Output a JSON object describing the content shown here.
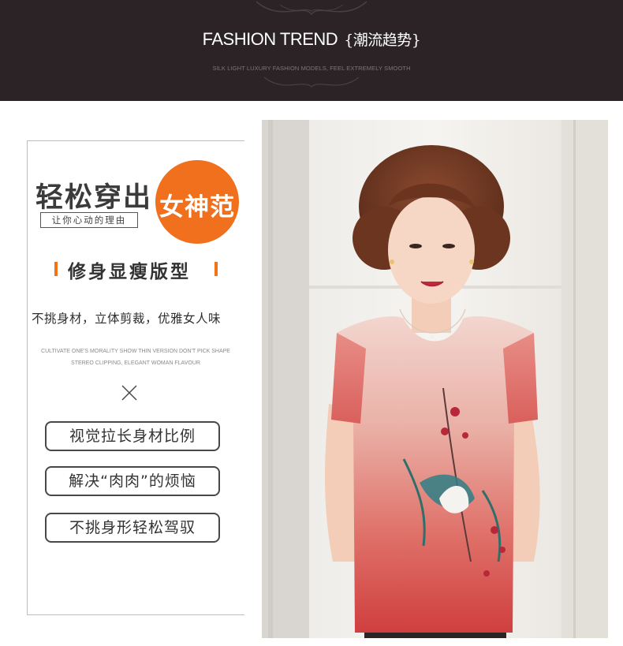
{
  "header": {
    "title_en": "FASHION TREND",
    "title_cn": "{潮流趋势}",
    "subtitle": "SILK LIGHT LUXURY FASHION MODELS, FEEL EXTREMELY SMOOTH"
  },
  "promo": {
    "headline": "轻松穿出",
    "badge": "女神范",
    "subheadline": "让你心动的理由",
    "feature_title": "修身显瘦版型",
    "description": "不挑身材，立体剪裁，优雅女人味",
    "english_line_1": "CULTIVATE ONE'S MORALITY SHOW THIN VERSION DON'T PICK SHAPE",
    "english_line_2": "STEREO CLIPPING, ELEGANT WOMAN FLAVOUR",
    "benefits": [
      "视觉拉长身材比例",
      "解决“肉肉”的烦恼",
      "不挑身形轻松驾驭"
    ]
  },
  "colors": {
    "header_bg": "#2b2325",
    "accent_orange": "#f0701e",
    "blouse_top": "#f2d6cf",
    "blouse_bottom": "#cf3f3f"
  }
}
